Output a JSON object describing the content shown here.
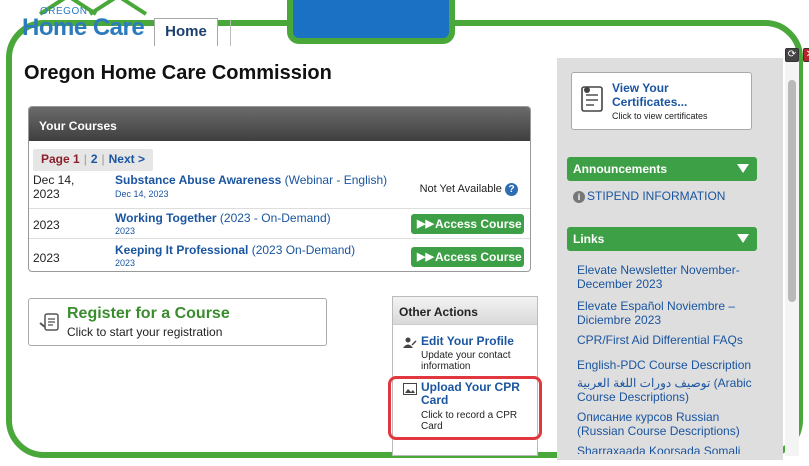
{
  "header": {
    "logo_small": "OREGON",
    "logo_main": "Home Care",
    "home_tab": "Home",
    "refresh_icon": "refresh-icon",
    "close_icon": "close-icon"
  },
  "page_title": "Oregon Home Care Commission",
  "courses": {
    "heading": "Your Courses",
    "pager": {
      "current": "Page 1",
      "page2": "2",
      "next": "Next >"
    },
    "rows": [
      {
        "date": "Dec 14, 2023",
        "name": "Substance Abuse Awareness",
        "detail": " (Webinar - English)",
        "sub": "Dec 14, 2023",
        "status": "Not Yet Available"
      },
      {
        "date": "2023",
        "name": "Working Together",
        "detail": " (2023 - On-Demand)",
        "sub": "2023",
        "action": "Access Course"
      },
      {
        "date": "2023",
        "name": "Keeping It Professional",
        "detail": " (2023 On-Demand)",
        "sub": "2023",
        "action": "Access Course"
      }
    ]
  },
  "register": {
    "title": "Register for a Course",
    "subtitle": "Click to start your registration"
  },
  "other_actions": {
    "heading": "Other Actions",
    "edit_profile": {
      "title": "Edit Your Profile",
      "desc": "Update your contact information"
    },
    "upload_cpr": {
      "title": "Upload Your CPR Card",
      "desc": "Click to record a CPR Card"
    }
  },
  "sidebar": {
    "certificates": {
      "title": "View Your Certificates...",
      "subtitle": "Click to view certificates"
    },
    "announcements_heading": "Announcements",
    "stipend": "STIPEND INFORMATION",
    "links_heading": "Links",
    "links": [
      "Elevate Newsletter November-December 2023",
      "Elevate Español Noviembre – Diciembre 2023",
      "CPR/First Aid Differential FAQs",
      "English-PDC Course Description",
      "توصيف دورات اللغة العربية (Arabic Course Descriptions)",
      "Описание курсов Russian (Russian Course Descriptions)",
      "Sharraxaada Koorsada Somali"
    ]
  },
  "colors": {
    "accent_green": "#4aa83a",
    "button_green": "#3ea046",
    "link_blue": "#1a55a0",
    "highlight_red": "#e0383e"
  }
}
